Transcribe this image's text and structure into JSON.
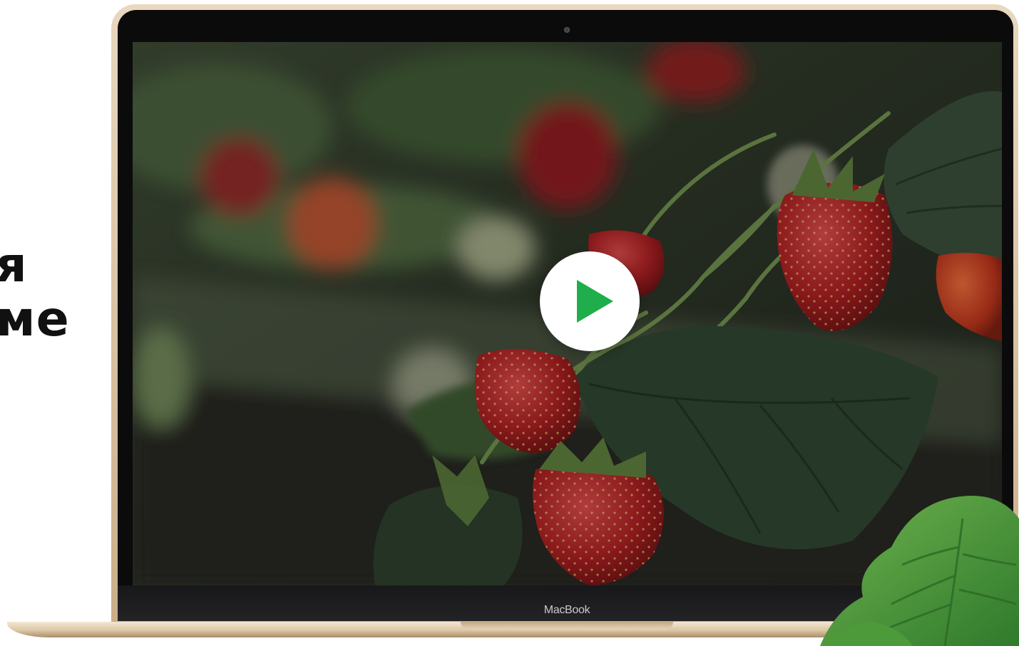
{
  "heading": {
    "line1": "я",
    "line2": "ме"
  },
  "laptop": {
    "brand_label": "MacBook"
  },
  "video": {
    "play_icon": "play-icon"
  },
  "colors": {
    "play_accent": "#1fae4b",
    "frame_gold": "#d8c1a0",
    "heading_text": "#111111"
  }
}
